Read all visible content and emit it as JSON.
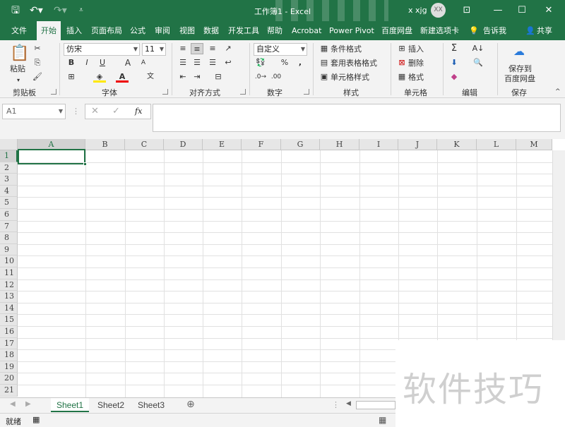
{
  "titlebar": {
    "title": "工作簿1  -  Excel",
    "user": "x xjg",
    "avatar": "XX"
  },
  "tabs": [
    "文件",
    "开始",
    "插入",
    "页面布局",
    "公式",
    "审阅",
    "视图",
    "数据",
    "开发工具",
    "帮助",
    "Acrobat",
    "Power Pivot",
    "百度网盘",
    "新建选项卡"
  ],
  "tell_me": "告诉我",
  "share": "共享",
  "ribbon": {
    "clipboard": {
      "label": "剪贴板",
      "paste": "粘贴"
    },
    "font": {
      "label": "字体",
      "name": "仿宋",
      "size": "11",
      "bold": "B",
      "italic": "I",
      "underline": "U",
      "grow": "A",
      "shrink": "A",
      "color": "A",
      "phonetic": "文"
    },
    "alignment": {
      "label": "对齐方式"
    },
    "number": {
      "label": "数字",
      "format": "自定义",
      "percent": "%"
    },
    "styles": {
      "label": "样式",
      "conditional": "条件格式",
      "table": "套用表格格式",
      "cell": "单元格样式"
    },
    "cells": {
      "label": "单元格",
      "insert": "插入",
      "delete": "删除",
      "format": "格式"
    },
    "editing": {
      "label": "编辑"
    },
    "save": {
      "label": "保存",
      "button_line1": "保存到",
      "button_line2": "百度网盘"
    }
  },
  "formula_bar": {
    "name_box": "A1",
    "fx": "fx",
    "value": ""
  },
  "grid": {
    "columns": [
      "A",
      "B",
      "C",
      "D",
      "E",
      "F",
      "G",
      "H",
      "I",
      "J",
      "K",
      "L",
      "M"
    ],
    "rows": [
      "1",
      "2",
      "3",
      "4",
      "5",
      "6",
      "7",
      "8",
      "9",
      "10",
      "11",
      "12",
      "13",
      "14",
      "15",
      "16",
      "17",
      "18",
      "19",
      "20",
      "21"
    ]
  },
  "sheets": [
    "Sheet1",
    "Sheet2",
    "Sheet3"
  ],
  "status": {
    "ready": "就绪"
  },
  "watermark": "软件技巧",
  "colors": {
    "accent": "#217346",
    "ribbon_bg": "#f3f3f3"
  }
}
